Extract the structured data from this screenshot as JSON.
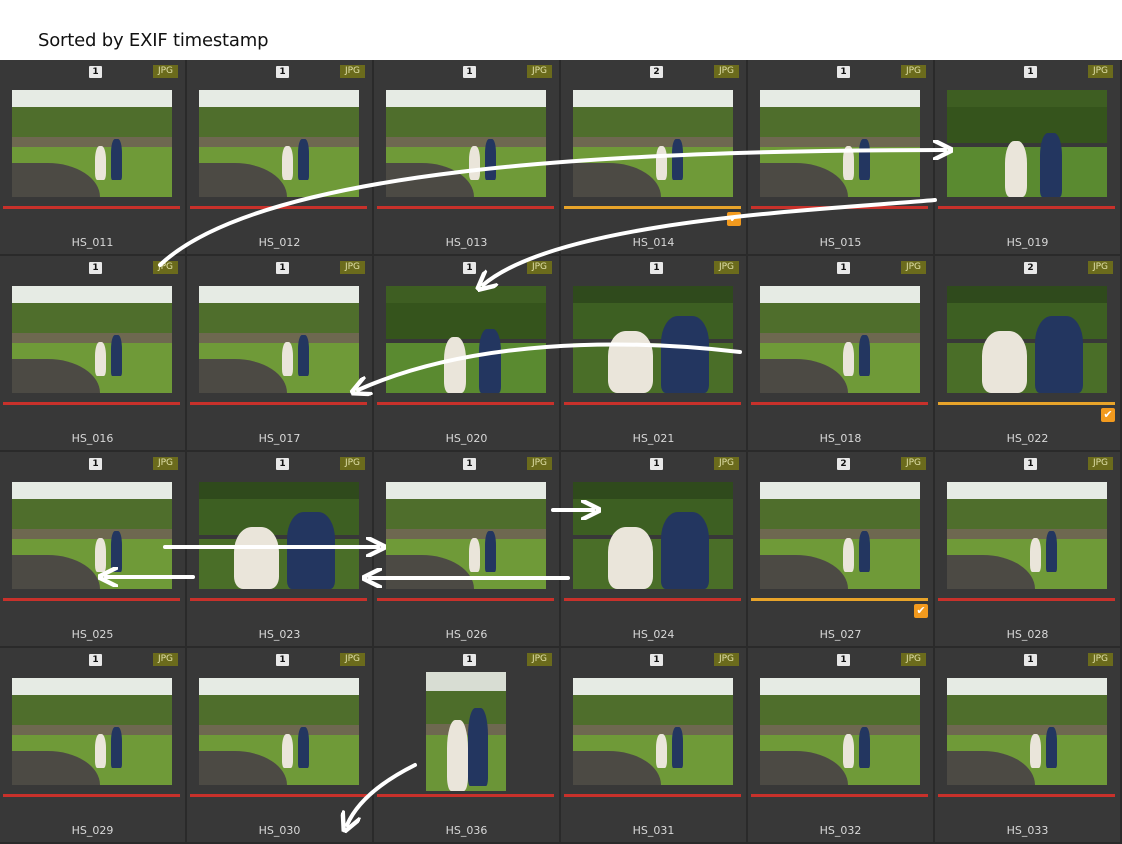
{
  "header": {
    "title": "Sorted by EXIF timestamp"
  },
  "colors": {
    "reject_bar": "#c8312b",
    "pick_bar": "#e8a42a",
    "check": "#f29a1e",
    "jpg_badge": "#6b6b1c",
    "arrow": "#ffffff"
  },
  "icons": {
    "check": "checkmark-icon",
    "arrow": "arrow-annotation"
  },
  "thumbnails": [
    {
      "filename": "HS_011",
      "count": "1",
      "type": "JPG",
      "status": "red",
      "checked": false,
      "scene": "wide"
    },
    {
      "filename": "HS_012",
      "count": "1",
      "type": "JPG",
      "status": "red",
      "checked": false,
      "scene": "wide"
    },
    {
      "filename": "HS_013",
      "count": "1",
      "type": "JPG",
      "status": "red",
      "checked": false,
      "scene": "wide"
    },
    {
      "filename": "HS_014",
      "count": "2",
      "type": "JPG",
      "status": "yellow",
      "checked": true,
      "scene": "wide"
    },
    {
      "filename": "HS_015",
      "count": "1",
      "type": "JPG",
      "status": "red",
      "checked": false,
      "scene": "wide"
    },
    {
      "filename": "HS_019",
      "count": "1",
      "type": "JPG",
      "status": "red",
      "checked": false,
      "scene": "foliage"
    },
    {
      "filename": "HS_016",
      "count": "1",
      "type": "JPG",
      "status": "red",
      "checked": false,
      "scene": "wide"
    },
    {
      "filename": "HS_017",
      "count": "1",
      "type": "JPG",
      "status": "red",
      "checked": false,
      "scene": "wide"
    },
    {
      "filename": "HS_020",
      "count": "1",
      "type": "JPG",
      "status": "red",
      "checked": false,
      "scene": "foliage"
    },
    {
      "filename": "HS_021",
      "count": "1",
      "type": "JPG",
      "status": "red",
      "checked": false,
      "scene": "closeup"
    },
    {
      "filename": "HS_018",
      "count": "1",
      "type": "JPG",
      "status": "red",
      "checked": false,
      "scene": "wide"
    },
    {
      "filename": "HS_022",
      "count": "2",
      "type": "JPG",
      "status": "yellow",
      "checked": true,
      "scene": "closeup"
    },
    {
      "filename": "HS_025",
      "count": "1",
      "type": "JPG",
      "status": "red",
      "checked": false,
      "scene": "wide"
    },
    {
      "filename": "HS_023",
      "count": "1",
      "type": "JPG",
      "status": "red",
      "checked": false,
      "scene": "closeup"
    },
    {
      "filename": "HS_026",
      "count": "1",
      "type": "JPG",
      "status": "red",
      "checked": false,
      "scene": "wide"
    },
    {
      "filename": "HS_024",
      "count": "1",
      "type": "JPG",
      "status": "red",
      "checked": false,
      "scene": "closeup"
    },
    {
      "filename": "HS_027",
      "count": "2",
      "type": "JPG",
      "status": "yellow",
      "checked": true,
      "scene": "wide"
    },
    {
      "filename": "HS_028",
      "count": "1",
      "type": "JPG",
      "status": "red",
      "checked": false,
      "scene": "wide"
    },
    {
      "filename": "HS_029",
      "count": "1",
      "type": "JPG",
      "status": "red",
      "checked": false,
      "scene": "wide"
    },
    {
      "filename": "HS_030",
      "count": "1",
      "type": "JPG",
      "status": "red",
      "checked": false,
      "scene": "wide"
    },
    {
      "filename": "HS_036",
      "count": "1",
      "type": "JPG",
      "status": "red",
      "checked": false,
      "scene": "portrait"
    },
    {
      "filename": "HS_031",
      "count": "1",
      "type": "JPG",
      "status": "red",
      "checked": false,
      "scene": "wide"
    },
    {
      "filename": "HS_032",
      "count": "1",
      "type": "JPG",
      "status": "red",
      "checked": false,
      "scene": "wide"
    },
    {
      "filename": "HS_033",
      "count": "1",
      "type": "JPG",
      "status": "red",
      "checked": false,
      "scene": "wide"
    }
  ]
}
